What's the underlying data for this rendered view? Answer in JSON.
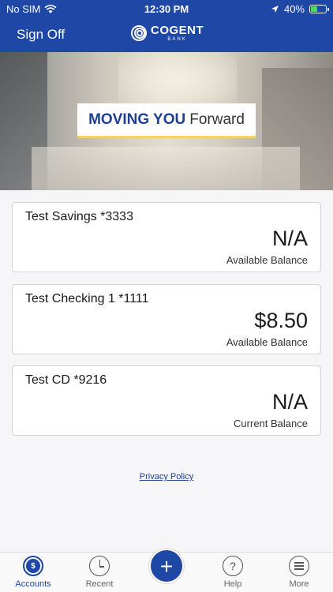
{
  "status_bar": {
    "carrier": "No SIM",
    "time": "12:30 PM",
    "battery": "40%",
    "battery_level": 0.4
  },
  "navbar": {
    "sign_off": "Sign Off",
    "logo_name": "COGENT",
    "logo_sub": "BANK"
  },
  "hero": {
    "banner_strong": "MOVING YOU",
    "banner_light": "Forward"
  },
  "accounts": [
    {
      "name": "Test Savings *3333",
      "amount": "N/A",
      "label": "Available Balance"
    },
    {
      "name": "Test Checking 1 *1111",
      "amount": "$8.50",
      "label": "Available Balance"
    },
    {
      "name": "Test CD *9216",
      "amount": "N/A",
      "label": "Current Balance"
    }
  ],
  "privacy_policy": "Privacy Policy",
  "tabbar": {
    "accounts": "Accounts",
    "recent": "Recent",
    "add": "+",
    "help": "Help",
    "help_glyph": "?",
    "more": "More",
    "accounts_glyph": "$"
  },
  "colors": {
    "brand_blue": "#1f47a6",
    "banner_underline": "#f2d46b"
  }
}
